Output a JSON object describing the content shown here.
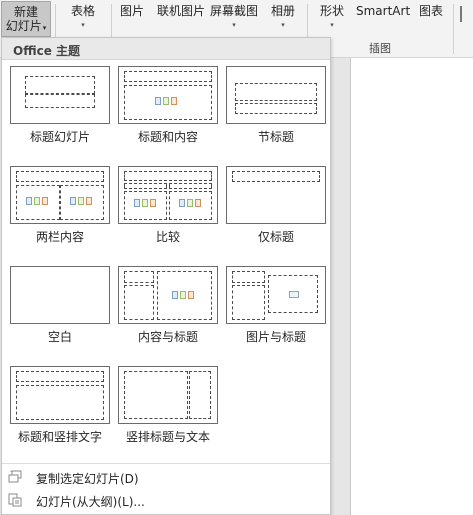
{
  "ribbon": {
    "new_slide": {
      "line1": "新建",
      "line2": "幻灯片",
      "arrow": "▾"
    },
    "table": {
      "label": "表格",
      "arrow": "▾"
    },
    "picture": {
      "label": "图片"
    },
    "online_picture": {
      "label": "联机图片"
    },
    "screenshot": {
      "label": "屏幕截图",
      "arrow": "▾"
    },
    "album": {
      "label": "相册",
      "arrow": "▾"
    },
    "shapes": {
      "label": "形状",
      "arrow": "▾"
    },
    "smartart": {
      "label": "SmartArt"
    },
    "chart": {
      "label": "图表"
    },
    "group_illustrations": "插图"
  },
  "menu": {
    "header": "Office 主题",
    "layouts": [
      {
        "name": "标题幻灯片"
      },
      {
        "name": "标题和内容"
      },
      {
        "name": "节标题"
      },
      {
        "name": "两栏内容"
      },
      {
        "name": "比较"
      },
      {
        "name": "仅标题"
      },
      {
        "name": "空白"
      },
      {
        "name": "内容与标题"
      },
      {
        "name": "图片与标题"
      },
      {
        "name": "标题和竖排文字"
      },
      {
        "name": "竖排标题与文本"
      }
    ],
    "items": [
      {
        "label": "复制选定幻灯片(D)",
        "icon": "duplicate-slide-icon"
      },
      {
        "label": "幻灯片(从大纲)(L)...",
        "icon": "outline-slides-icon"
      }
    ]
  },
  "colors": {
    "accent_selected": "#c8c8c8",
    "ribbon_bg": "#f3f3f3",
    "menu_header_bg": "#e9e9e9"
  }
}
